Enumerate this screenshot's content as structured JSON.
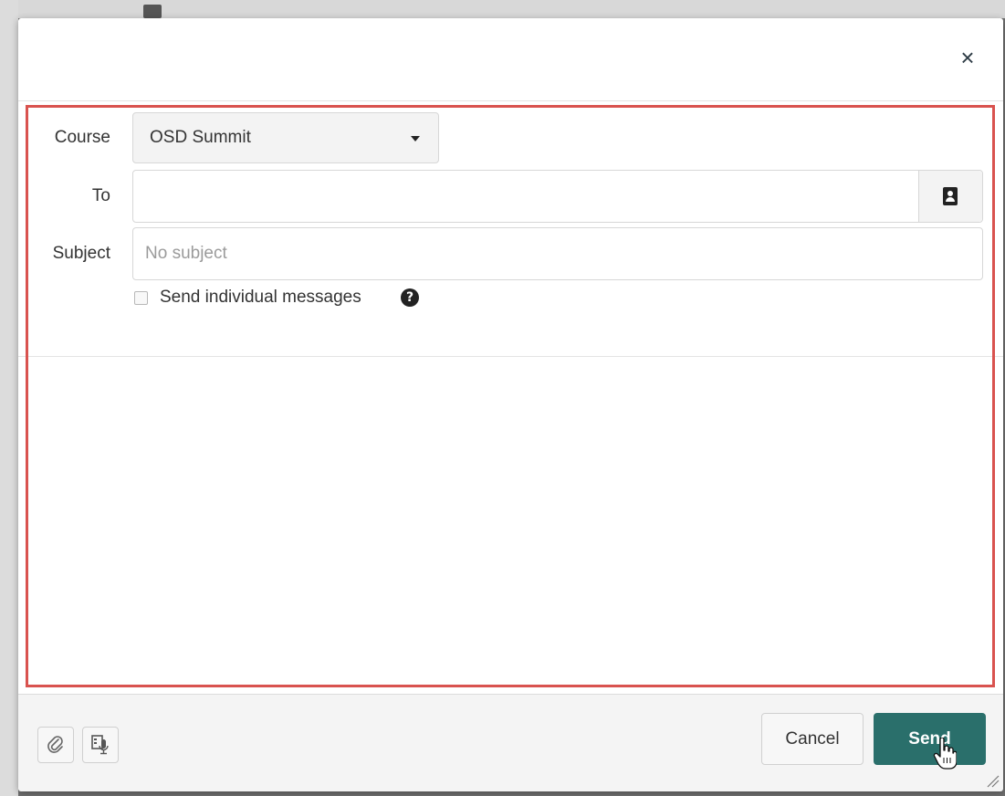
{
  "dialog": {
    "close_label": "×"
  },
  "form": {
    "course_label": "Course",
    "course_value": "OSD Summit",
    "to_label": "To",
    "to_value": "",
    "subject_label": "Subject",
    "subject_placeholder": "No subject",
    "individual_messages_label": "Send individual messages",
    "help_glyph": "?"
  },
  "footer": {
    "attach_icon": "paperclip-icon",
    "media_icon": "media-record-icon",
    "cancel_label": "Cancel",
    "send_label": "Send"
  },
  "colors": {
    "send_button": "#2a6f6b",
    "highlight_border": "#d9534f"
  }
}
